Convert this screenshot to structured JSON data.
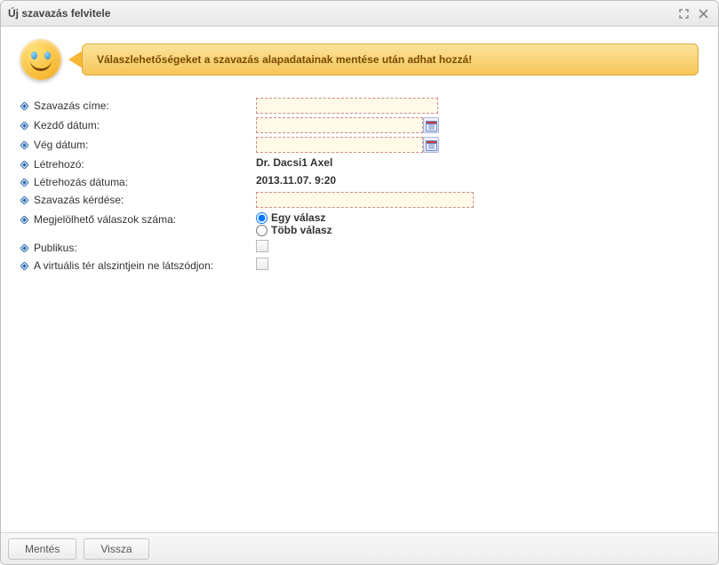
{
  "window": {
    "title": "Új szavazás felvitele"
  },
  "hint": "Válaszlehetőségeket a szavazás alapadatainak mentése után adhat hozzá!",
  "labels": {
    "title": "Szavazás címe:",
    "start_date": "Kezdő dátum:",
    "end_date": "Vég dátum:",
    "creator": "Létrehozó:",
    "created_at": "Létrehozás dátuma:",
    "question": "Szavazás kérdése:",
    "answer_count": "Megjelölhető válaszok száma:",
    "public": "Publikus:",
    "hide_sub": "A virtuális tér alszintjein ne látszódjon:"
  },
  "values": {
    "title": "",
    "start_date": "",
    "end_date": "",
    "creator": "Dr. Dacsi1 Axel",
    "created_at": "2013.11.07. 9:20",
    "question": "",
    "answer_mode_single": "Egy válasz",
    "answer_mode_multi": "Több válasz",
    "answer_mode_selected": "single",
    "public": false,
    "hide_sub": false
  },
  "buttons": {
    "save": "Mentés",
    "back": "Vissza"
  }
}
